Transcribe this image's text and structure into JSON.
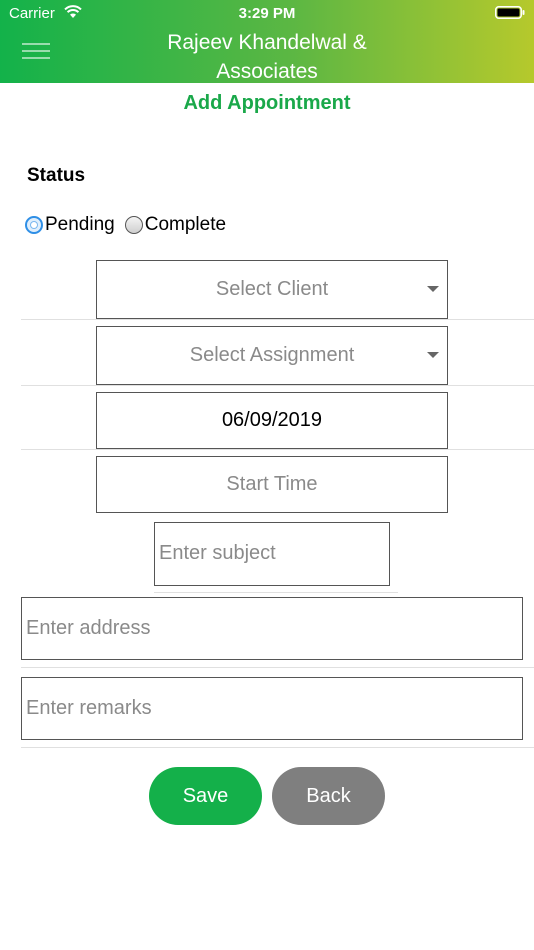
{
  "status_bar": {
    "carrier": "Carrier",
    "time": "3:29 PM"
  },
  "header": {
    "title": "Rajeev Khandelwal & Associates",
    "menu_icon": "hamburger-menu-icon"
  },
  "page": {
    "title": "Add Appointment"
  },
  "status": {
    "label": "Status",
    "options": [
      {
        "label": "Pending",
        "selected": true
      },
      {
        "label": "Complete",
        "selected": false
      }
    ]
  },
  "form": {
    "client_placeholder": "Select Client",
    "assignment_placeholder": "Select Assignment",
    "date_value": "06/09/2019",
    "start_time_placeholder": "Start Time",
    "subject_placeholder": "Enter subject",
    "address_placeholder": "Enter address",
    "remarks_placeholder": "Enter remarks"
  },
  "buttons": {
    "save": "Save",
    "back": "Back"
  },
  "colors": {
    "primary_green": "#14b04a",
    "header_gradient_end": "#b6c92c",
    "back_gray": "#7f7f7f",
    "title_green": "#1aa84a"
  }
}
